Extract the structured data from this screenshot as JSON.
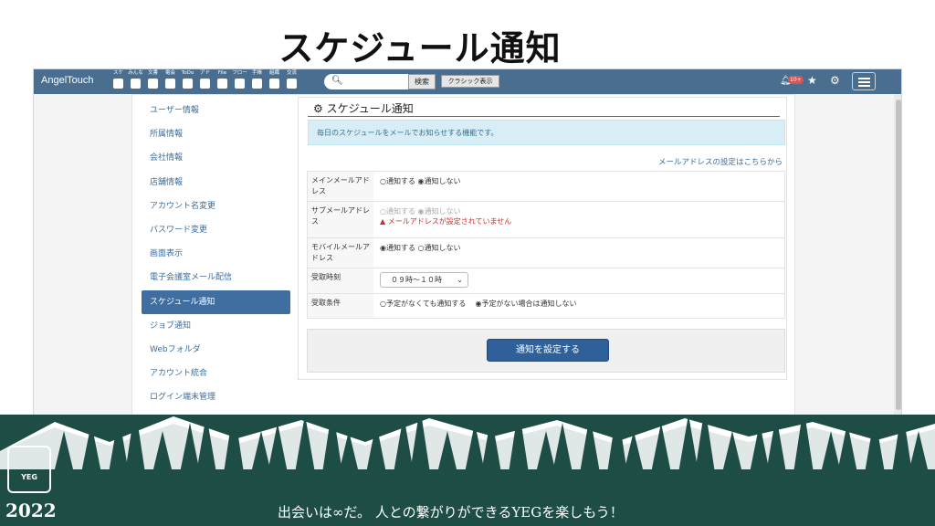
{
  "slide": {
    "title": "スケジュール通知",
    "footer_year": "2022",
    "footer_slogan": "出会いは∞だ。 人との繋がりができるYEGを楽しもう！",
    "logo_text": "YEG"
  },
  "app": {
    "brand": "AngelTouch",
    "toolbar": [
      {
        "label": "スケ",
        "icon": "calendar-day-icon"
      },
      {
        "label": "みんな",
        "icon": "calendar-icon"
      },
      {
        "label": "文書",
        "icon": "document-icon"
      },
      {
        "label": "電会",
        "icon": "chat-icon"
      },
      {
        "label": "ToDo",
        "icon": "list-icon"
      },
      {
        "label": "アド",
        "icon": "user-icon"
      },
      {
        "label": "File",
        "icon": "folder-icon"
      },
      {
        "label": "フロー",
        "icon": "recycle-icon"
      },
      {
        "label": "手帳",
        "icon": "notebook-icon"
      },
      {
        "label": "組織",
        "icon": "org-chart-icon"
      },
      {
        "label": "交流",
        "icon": "handshake-icon"
      }
    ],
    "search_placeholder": "",
    "search_button": "検索",
    "classic_button": "クラシック表示",
    "notification_badge": "10+"
  },
  "sidebar": {
    "items": [
      {
        "label": "ユーザー情報",
        "active": false
      },
      {
        "label": "所属情報",
        "active": false
      },
      {
        "label": "会社情報",
        "active": false
      },
      {
        "label": "店舗情報",
        "active": false
      },
      {
        "label": "アカウント名変更",
        "active": false
      },
      {
        "label": "パスワード変更",
        "active": false
      },
      {
        "label": "画面表示",
        "active": false
      },
      {
        "label": "電子会議室メール配信",
        "active": false
      },
      {
        "label": "スケジュール通知",
        "active": true
      },
      {
        "label": "ジョブ通知",
        "active": false
      },
      {
        "label": "Webフォルダ",
        "active": false
      },
      {
        "label": "アカウント統合",
        "active": false
      },
      {
        "label": "ログイン端末管理",
        "active": false
      }
    ]
  },
  "main": {
    "title": "スケジュール通知",
    "info": "毎日のスケジュールをメールでお知らせする機能です。",
    "address_link": "メールアドレスの設定はこちらから",
    "rows": {
      "main_mail": {
        "label": "メインメールアドレス",
        "opt1": "○通知する",
        "opt2": "◉通知しない"
      },
      "sub_mail": {
        "label": "サブメールアドレス",
        "opt1": "○通知する",
        "opt2": "◉通知しない",
        "error": "メールアドレスが設定されていません"
      },
      "mobile_mail": {
        "label": "モバイルメールアドレス",
        "opt1": "◉通知する",
        "opt2": "○通知しない"
      },
      "receive_time": {
        "label": "受取時刻",
        "value": "０９時～１０時"
      },
      "receive_condition": {
        "label": "受取条件",
        "opt1": "○予定がなくても通知する",
        "opt2": "◉予定がない場合は通知しない"
      }
    },
    "submit": "通知を設定する"
  },
  "colors": {
    "topbar": "#4a6e8f",
    "accent": "#3f6fa0",
    "button": "#2e6099",
    "footer": "#1d4d45",
    "error": "#c9302c"
  }
}
